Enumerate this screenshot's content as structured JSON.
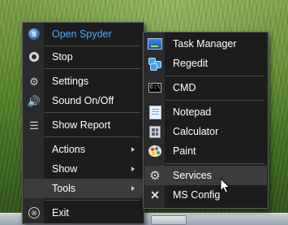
{
  "main_menu": {
    "items": [
      {
        "label": "Open Spyder",
        "icon": "spyder-logo-icon",
        "accent": "#4aa8ff"
      },
      {
        "label": "Stop",
        "icon": "stop-icon"
      },
      {
        "label": "Settings",
        "icon": "settings-icon"
      },
      {
        "label": "Sound On/Off",
        "icon": "speaker-icon"
      },
      {
        "label": "Show Report",
        "icon": "report-list-icon"
      },
      {
        "label": "Actions",
        "submenu": true
      },
      {
        "label": "Show",
        "submenu": true
      },
      {
        "label": "Tools",
        "submenu": true,
        "selected": true
      },
      {
        "label": "Exit",
        "icon": "exit-icon"
      }
    ]
  },
  "tools_submenu": {
    "items": [
      {
        "label": "Task Manager",
        "icon": "task-manager-icon"
      },
      {
        "label": "Regedit",
        "icon": "regedit-icon"
      },
      {
        "label": "CMD",
        "icon": "cmd-icon"
      },
      {
        "label": "Notepad",
        "icon": "notepad-icon"
      },
      {
        "label": "Calculator",
        "icon": "calculator-icon"
      },
      {
        "label": "Paint",
        "icon": "paint-icon"
      },
      {
        "label": "Services",
        "icon": "gear-icon",
        "hovered": true
      },
      {
        "label": "MS Config",
        "icon": "tools-icon"
      }
    ]
  },
  "colors": {
    "menu_bg": "#1c1c1c",
    "icon_column": "#2b2b2b",
    "highlight": "#3c3c3c",
    "accent": "#4aa8ff"
  }
}
